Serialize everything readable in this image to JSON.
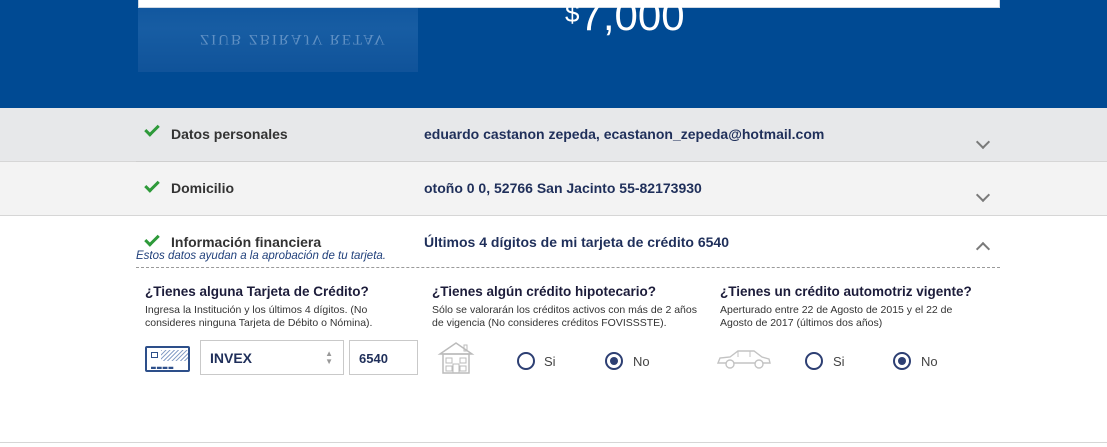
{
  "banner": {
    "photo_text": "ZIUB ZBIRAJV RETAV",
    "currency_symbol": "$",
    "amount": "7,000",
    "background_color": "#004a93"
  },
  "sections": [
    {
      "label": "Datos personales",
      "value": "eduardo castanon zepeda, ecastanon_zepeda@hotmail.com",
      "complete": true,
      "expanded": false
    },
    {
      "label": "Domicilio",
      "value": "otoño 0 0, 52766 San Jacinto 55-82173930",
      "complete": true,
      "expanded": false
    },
    {
      "label": "Información financiera",
      "value": "Últimos 4 dígitos de mi tarjeta de crédito 6540",
      "subtitle": "Estos datos ayudan a la aprobación de tu tarjeta.",
      "complete": true,
      "expanded": true
    }
  ],
  "financial": {
    "credit_card": {
      "title": "¿Tienes alguna Tarjeta de Crédito?",
      "desc_line1": "Ingresa la Institución y los últimos 4 dígitos. (No",
      "desc_line2": "consideres ninguna Tarjeta de Débito o Nómina).",
      "institution_selected": "INVEX",
      "last_digits": "6540",
      "icon": "credit-card-icon"
    },
    "mortgage": {
      "title": "¿Tienes algún crédito hipotecario?",
      "desc_line1": "Sólo se valorarán los créditos activos con más de 2 años",
      "desc_line2": "de vigencia (No consideres créditos FOVISSSTE).",
      "icon": "house-icon",
      "option_yes": "Si",
      "option_no": "No",
      "selected": "No"
    },
    "auto": {
      "title": "¿Tienes un crédito automotriz vigente?",
      "desc_line1": "Aperturado entre 22 de Agosto de 2015 y el 22 de",
      "desc_line2": "Agosto de 2017 (últimos dos años)",
      "icon": "car-icon",
      "option_yes": "Si",
      "option_no": "No",
      "selected": "No"
    }
  },
  "colors": {
    "check": "#2e9a3a",
    "value_text": "#1f2f5a",
    "radio": "#2d3f73"
  }
}
